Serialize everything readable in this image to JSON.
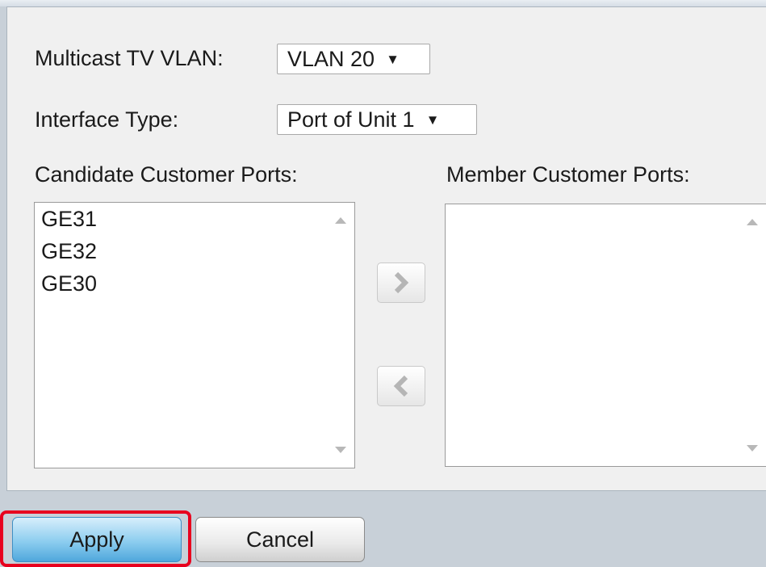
{
  "form": {
    "multicast_label": "Multicast TV VLAN:",
    "multicast_value": "VLAN 20",
    "interface_label": "Interface Type:",
    "interface_value": "Port of Unit 1",
    "candidate_label": "Candidate Customer Ports:",
    "member_label": "Member Customer Ports:",
    "candidate_ports": [
      "GE31",
      "GE32",
      "GE30"
    ],
    "member_ports": []
  },
  "icons": {
    "dropdown": "triangle-down-icon",
    "move_right": "chevron-right-icon",
    "move_left": "chevron-left-icon",
    "scroll_up": "scroll-up-icon",
    "scroll_down": "scroll-down-icon"
  },
  "buttons": {
    "apply_label": "Apply",
    "cancel_label": "Cancel"
  },
  "colors": {
    "highlight": "#e8001e",
    "apply_blue": "#8ccdef"
  }
}
